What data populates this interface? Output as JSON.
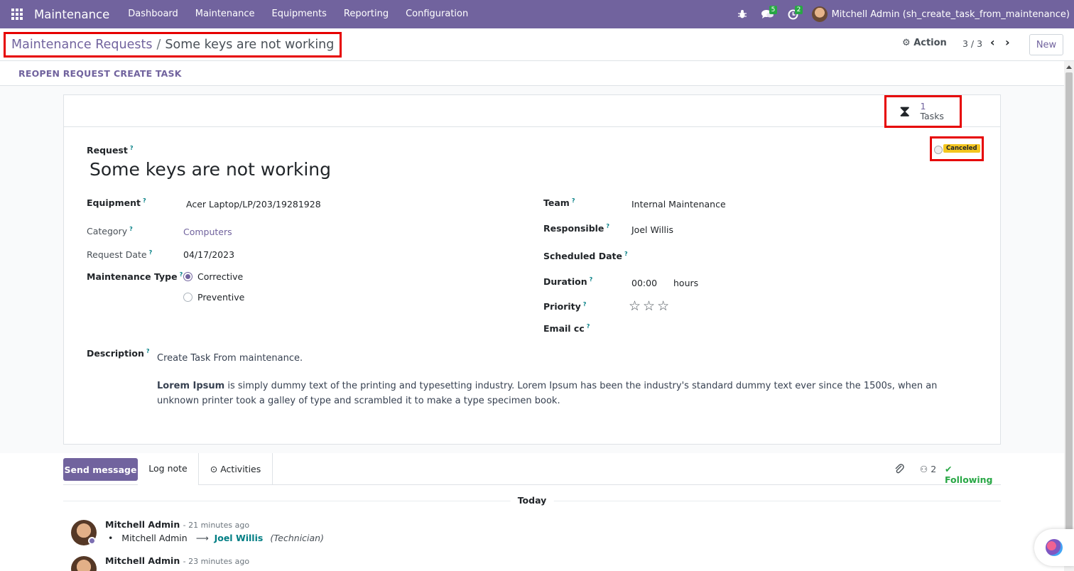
{
  "navbar": {
    "app_name": "Maintenance",
    "menu": [
      "Dashboard",
      "Maintenance",
      "Equipments",
      "Reporting",
      "Configuration"
    ],
    "messages_count": "5",
    "activities_count": "2",
    "user": "Mitchell Admin (sh_create_task_from_maintenance)"
  },
  "breadcrumb": {
    "parent": "Maintenance Requests",
    "separator": "/",
    "current": "Some keys are not working"
  },
  "control": {
    "action_label": "Action",
    "pager": "3 / 3",
    "new_label": "New"
  },
  "statusbar": {
    "reopen_label": "REOPEN REQUEST",
    "create_task_label": "CREATE TASK"
  },
  "smart_button": {
    "count": "1",
    "label": "Tasks"
  },
  "state": {
    "label": "Canceled",
    "color": "#f3c61f"
  },
  "form": {
    "request_label": "Request",
    "title": "Some keys are not working",
    "equipment_label": "Equipment",
    "equipment_value": "Acer Laptop/LP/203/19281928",
    "category_label": "Category",
    "category_value": "Computers",
    "request_date_label": "Request Date",
    "request_date_value": "04/17/2023",
    "maintenance_type_label": "Maintenance Type",
    "maintenance_type_options": [
      "Corrective",
      "Preventive"
    ],
    "maintenance_type_selected": "Corrective",
    "team_label": "Team",
    "team_value": "Internal Maintenance",
    "responsible_label": "Responsible",
    "responsible_value": "Joel Willis",
    "scheduled_date_label": "Scheduled Date",
    "duration_label": "Duration",
    "duration_value": "00:00",
    "duration_unit": "hours",
    "priority_label": "Priority",
    "priority_stars": 0,
    "email_cc_label": "Email cc",
    "description_label": "Description",
    "description_line1": "Create Task From maintenance.",
    "description_bold": "Lorem Ipsum",
    "description_rest": " is simply dummy text of the printing and typesetting industry. Lorem Ipsum has been the industry's standard dummy text ever since the 1500s, when an unknown printer took a galley of type and scrambled it to make a type specimen book."
  },
  "chatter": {
    "send_message_label": "Send message",
    "log_note_label": "Log note",
    "activities_label": "Activities",
    "followers_count": "2",
    "following_label": "Following",
    "date_separator": "Today",
    "messages": [
      {
        "author": "Mitchell Admin",
        "time": "- 21 minutes ago",
        "old_value": "Mitchell Admin",
        "new_value": "Joel Willis",
        "field": "(Technician)"
      },
      {
        "author": "Mitchell Admin",
        "time": "- 23 minutes ago"
      }
    ]
  },
  "accent_color": "#71639e"
}
